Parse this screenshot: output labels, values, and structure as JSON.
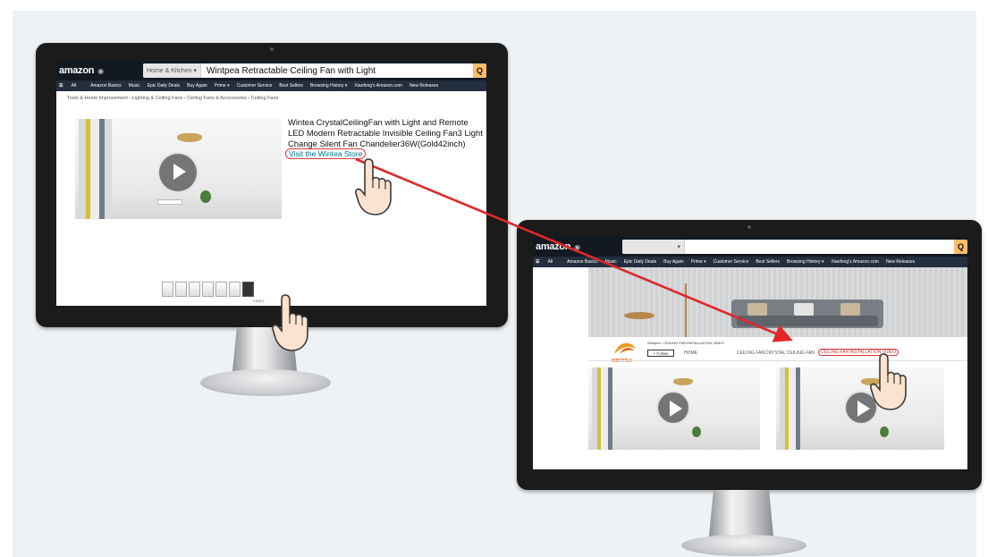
{
  "left_screen": {
    "logo": "amazon",
    "category": "Home & Kitchen ▾",
    "search_query": "Wintpea Retractable Ceiling Fan with Light",
    "search_button_glyph": "Q",
    "nav": {
      "all_label": "All",
      "items": [
        "Amazon Basics",
        "Music",
        "Epic Daily Deals",
        "Buy Again",
        "Prime ▾",
        "Customer Service",
        "Best Sellers",
        "Browsing History ▾",
        "Xiaofeng's Amazon.com",
        "New Releases"
      ]
    },
    "breadcrumb": "Tools & Home Improvement › Lighting & Ceiling Fans › Ceiling Fans & Accessories › Ceiling Fans",
    "product_title": "Wintea CrystalCeilingFan with Light and Remote LED Modern Retractable Invisible Ceiling Fan3 Light Change Silent Fan Chandelier36W(Gold42inch)",
    "store_link": "Visit the Wintea Store",
    "thumb_video_label": "VIDEO"
  },
  "right_screen": {
    "logo": "amazon",
    "category": "▾",
    "search_button_glyph": "Q",
    "nav": {
      "all_label": "All",
      "items": [
        "Amazon Basics",
        "Music",
        "Epic Daily Deals",
        "Buy Again",
        "Prime ▾",
        "Customer Service",
        "Best Sellers",
        "Browsing History ▾",
        "Xiaofeng's Amazon.com",
        "New Releases"
      ]
    },
    "store_brand": "WINTPEA",
    "store_breadcrumb": "Wintpea › CEILING FAN INSTALLATION VIDEO",
    "follow_label": "+ Follow",
    "tabs": [
      "HOME",
      "CEILING FAN",
      "CRYSTAL CEILING FAN",
      "CEILING FAN INSTALLATION VIDEO"
    ]
  },
  "colors": {
    "header_bg": "#131921",
    "nav_bg": "#232f3e",
    "search_button": "#febd69",
    "highlight_red": "#d93b3b",
    "link_teal": "#007185",
    "arrow_red": "#e02828"
  },
  "icons": [
    "hamburger-icon",
    "search-icon",
    "play-icon",
    "hand-pointer-icon",
    "arrow-icon",
    "location-icon"
  ]
}
